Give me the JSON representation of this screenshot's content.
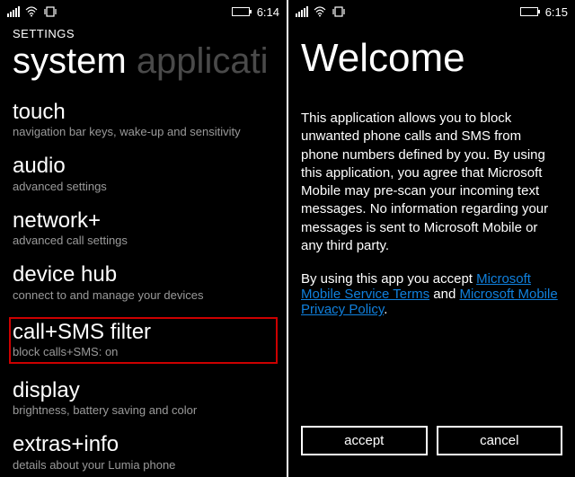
{
  "left": {
    "status": {
      "time": "6:14"
    },
    "overline": "SETTINGS",
    "pivot": {
      "active": "system",
      "inactive": "applicati"
    },
    "items": [
      {
        "title": "touch",
        "sub": "navigation bar keys, wake-up and sensitivity",
        "highlight": false
      },
      {
        "title": "audio",
        "sub": "advanced settings",
        "highlight": false
      },
      {
        "title": "network+",
        "sub": "advanced call settings",
        "highlight": false
      },
      {
        "title": "device hub",
        "sub": "connect to and manage your devices",
        "highlight": false
      },
      {
        "title": "call+SMS filter",
        "sub": "block calls+SMS: on",
        "highlight": true
      },
      {
        "title": "display",
        "sub": "brightness, battery saving and color",
        "highlight": false
      },
      {
        "title": "extras+info",
        "sub": "details about your Lumia phone",
        "highlight": false
      }
    ]
  },
  "right": {
    "status": {
      "time": "6:15"
    },
    "title": "Welcome",
    "body": "This application allows you to block unwanted phone calls and SMS from phone numbers defined by you. By using this application, you agree that Microsoft Mobile may pre-scan your incoming text messages. No information regarding your messages is sent to Microsoft Mobile or any third party.",
    "accept_prefix": "By using this app you accept ",
    "link1": "Microsoft Mobile Service Terms",
    "and": " and ",
    "link2": "Microsoft Mobile Privacy Policy",
    "period": ".",
    "buttons": {
      "accept": "accept",
      "cancel": "cancel"
    }
  }
}
